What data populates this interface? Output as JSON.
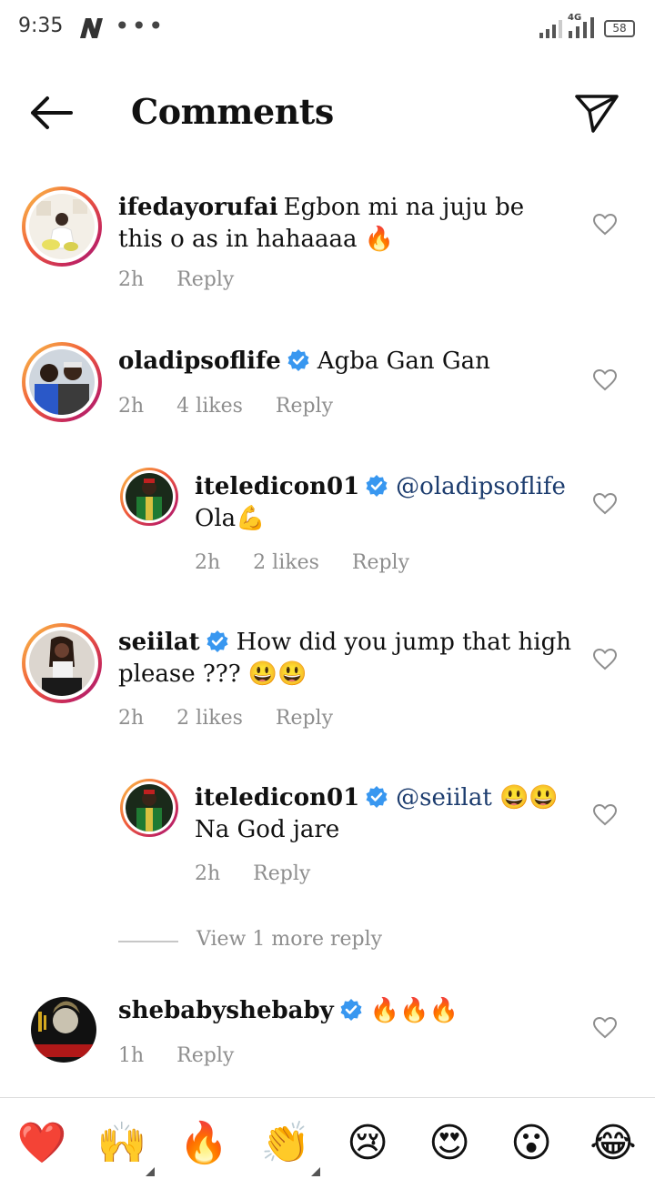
{
  "status_bar": {
    "time": "9:35",
    "network": "4G",
    "battery": "58"
  },
  "header": {
    "title": "Comments"
  },
  "comments": [
    {
      "username": "ifedayorufai",
      "verified": false,
      "text": "Egbon mi na juju be this o as in hahaaaa 🔥",
      "time": "2h",
      "likes": "",
      "reply": "Reply"
    },
    {
      "username": "oladipsoflife",
      "verified": true,
      "text": "Agba Gan Gan",
      "time": "2h",
      "likes": "4 likes",
      "reply": "Reply"
    },
    {
      "username": "iteledicon01",
      "verified": true,
      "mention": "@oladipsoflife",
      "text": "Ola💪",
      "time": "2h",
      "likes": "2 likes",
      "reply": "Reply"
    },
    {
      "username": "seiilat",
      "verified": true,
      "text": "How did you jump that high please ??? 😃😃",
      "time": "2h",
      "likes": "2 likes",
      "reply": "Reply"
    },
    {
      "username": "iteledicon01",
      "verified": true,
      "mention": "@seiilat",
      "mention_suffix": " 😃😃",
      "text": "Na God jare",
      "time": "2h",
      "likes": "",
      "reply": "Reply"
    },
    {
      "username": "shebabyshebaby",
      "verified": true,
      "text": "🔥🔥🔥",
      "time": "1h",
      "likes": "",
      "reply": "Reply"
    }
  ],
  "view_more": "View 1 more reply",
  "emoji_bar": [
    "❤️",
    "🙌",
    "🔥",
    "👏",
    "😢",
    "😍",
    "😮",
    "😂"
  ],
  "colors": {
    "verified_blue": "#3897f0",
    "meta_gray": "#8e8e8e",
    "mention_blue": "#1c3c6e"
  }
}
